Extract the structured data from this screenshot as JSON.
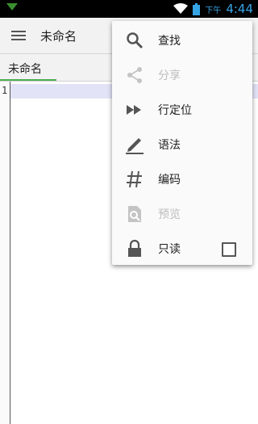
{
  "status_bar": {
    "ampm": "下午",
    "time": "4:44"
  },
  "action_bar": {
    "title": "未命名"
  },
  "tabs": [
    {
      "label": "未命名",
      "active": true
    }
  ],
  "editor": {
    "line_numbers": [
      "1"
    ],
    "content": ""
  },
  "overflow_menu": {
    "items": [
      {
        "label": "查找",
        "icon": "search-icon",
        "enabled": true
      },
      {
        "label": "分享",
        "icon": "share-icon",
        "enabled": false
      },
      {
        "label": "行定位",
        "icon": "fast-forward-icon",
        "enabled": true
      },
      {
        "label": "语法",
        "icon": "pen-icon",
        "enabled": true
      },
      {
        "label": "编码",
        "icon": "hash-icon",
        "enabled": true
      },
      {
        "label": "预览",
        "icon": "preview-icon",
        "enabled": false
      },
      {
        "label": "只读",
        "icon": "lock-icon",
        "enabled": true,
        "checkbox_checked": false
      }
    ]
  },
  "colors": {
    "accent": "#4caf50",
    "current_line": "#e2e3f6",
    "clock": "#36a5e6"
  }
}
